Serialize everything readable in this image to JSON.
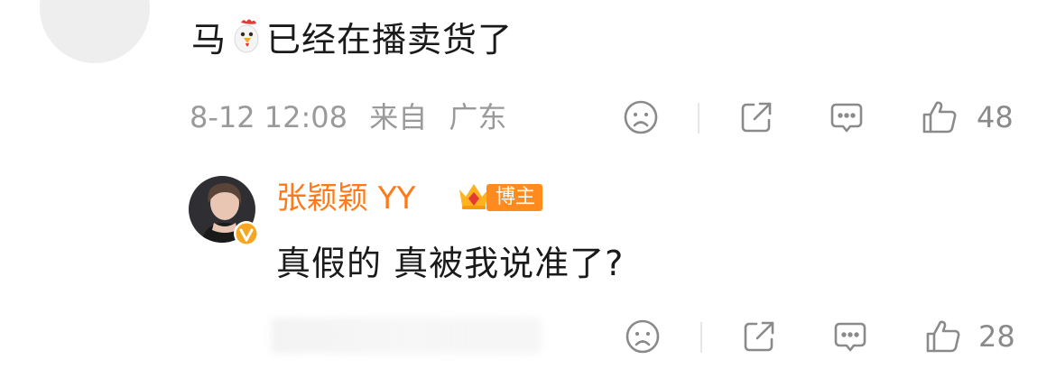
{
  "top_comment": {
    "text_before": "马",
    "emoji": "rooster-emoji",
    "text_after": "已经在播卖货了",
    "date": "8-12 12:08",
    "source_prefix": "来自",
    "location": "广东",
    "like_count": "48"
  },
  "reply": {
    "username": "张颖颖 YY",
    "badge_label": "博主",
    "text": "真假的 真被我说准了?",
    "like_count": "28"
  },
  "icons": {
    "dislike": "sad-face-icon",
    "share": "share-icon",
    "comment": "comment-icon",
    "like": "thumbs-up-icon",
    "verified": "verified-badge-icon",
    "crown": "crown-icon"
  },
  "colors": {
    "username": "#ff7a1a",
    "badge": "#ff8a1e",
    "meta": "#9a9a9a",
    "verified": "#f5a623"
  }
}
